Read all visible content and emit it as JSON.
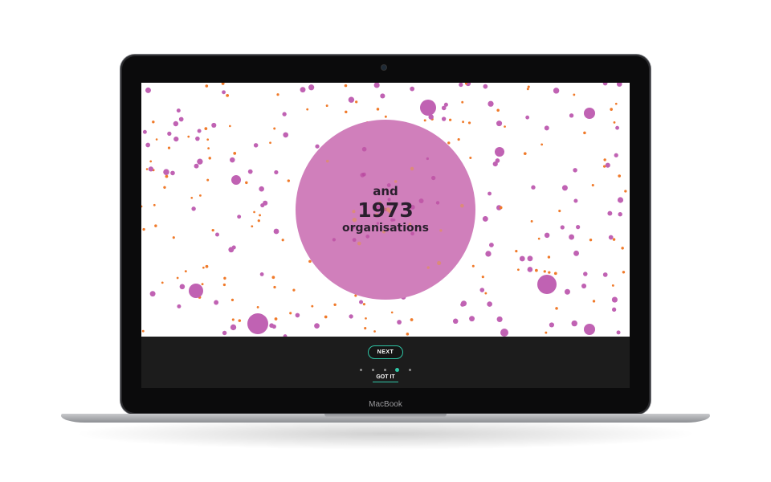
{
  "device": {
    "brand_label": "MacBook"
  },
  "hero": {
    "line1": "and",
    "number": "1973",
    "line3": "organisations"
  },
  "footer": {
    "next_label": "NEXT",
    "gotit_label": "GOT IT",
    "steps_total": 5,
    "active_step": 4
  },
  "colors": {
    "accent": "#2fc6a6",
    "bubble_pink": "#c062b3",
    "dot_orange": "#f07a2a",
    "big_circle": "#d07fbb",
    "footer_bg": "#1c1c1c"
  }
}
